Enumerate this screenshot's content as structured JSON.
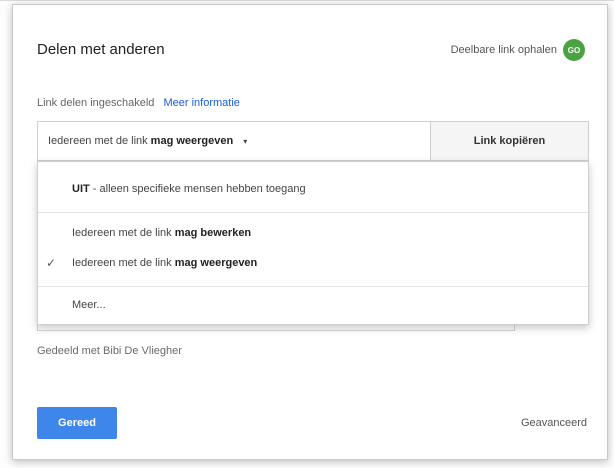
{
  "dialog": {
    "title": "Delen met anderen",
    "get_link_label": "Deelbare link ophalen",
    "go_badge": "GO"
  },
  "status": {
    "text": "Link delen ingeschakeld",
    "more_info": "Meer informatie"
  },
  "link_bar": {
    "access_prefix": "Iedereen met de link",
    "access_value": "mag weergeven",
    "caret": "▾",
    "copy_label": "Link kopiëren"
  },
  "dropdown": {
    "items": [
      {
        "bold": "UIT",
        "rest": " - alleen specifieke mensen hebben toegang",
        "checked": false
      },
      {
        "prefix": "Iedereen met de link ",
        "bold": "mag bewerken",
        "checked": false
      },
      {
        "prefix": "Iedereen met de link ",
        "bold": "mag weergeven",
        "checked": true
      },
      {
        "text": "Meer...",
        "checked": false
      }
    ],
    "check_glyph": "✓"
  },
  "shared_with": "Gedeeld met Bibi De Vliegher",
  "footer": {
    "done_label": "Gereed",
    "advanced_label": "Geavanceerd"
  },
  "colors": {
    "accent_blue": "#3f86ea",
    "link_blue": "#1a5ed6",
    "go_green": "#4aa243"
  }
}
